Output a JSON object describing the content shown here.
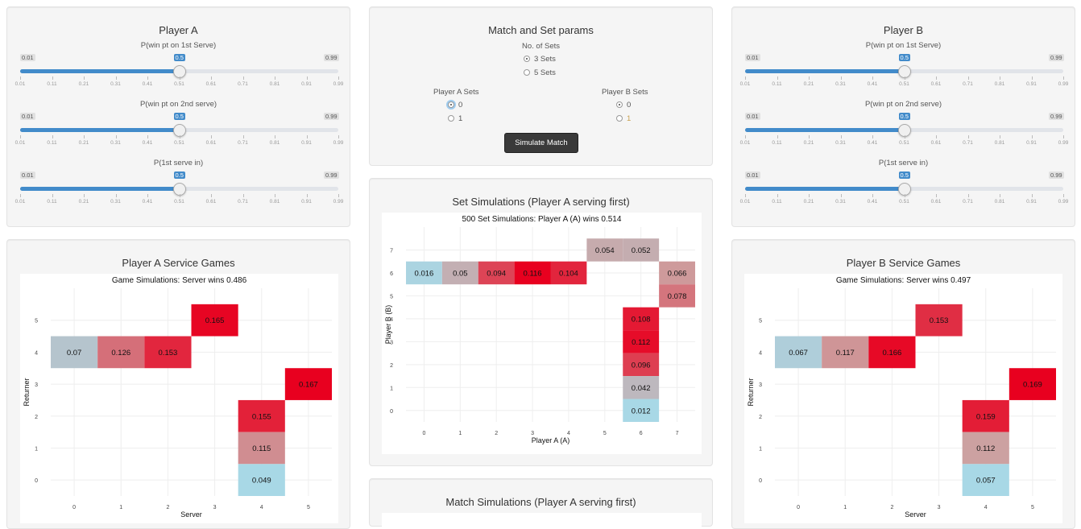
{
  "player_a": {
    "title": "Player A",
    "sliders": [
      {
        "label": "P(win pt on 1st Serve)",
        "min": "0.01",
        "max": "0.99",
        "value": "0.5",
        "fraction": 0.5
      },
      {
        "label": "P(win pt on 2nd serve)",
        "min": "0.01",
        "max": "0.99",
        "value": "0.5",
        "fraction": 0.5
      },
      {
        "label": "P(1st serve in)",
        "min": "0.01",
        "max": "0.99",
        "value": "0.5",
        "fraction": 0.5
      }
    ]
  },
  "player_b": {
    "title": "Player B",
    "sliders": [
      {
        "label": "P(win pt on 1st Serve)",
        "min": "0.01",
        "max": "0.99",
        "value": "0.5",
        "fraction": 0.5
      },
      {
        "label": "P(win pt on 2nd serve)",
        "min": "0.01",
        "max": "0.99",
        "value": "0.5",
        "fraction": 0.5
      },
      {
        "label": "P(1st serve in)",
        "min": "0.01",
        "max": "0.99",
        "value": "0.5",
        "fraction": 0.5
      }
    ]
  },
  "slider_ticks": [
    "0.01",
    "0.11",
    "0.21",
    "0.31",
    "0.41",
    "0.51",
    "0.61",
    "0.71",
    "0.81",
    "0.91",
    "0.99"
  ],
  "match_params": {
    "title": "Match and Set params",
    "sets_label": "No. of Sets",
    "sets_options": [
      {
        "label": "3 Sets",
        "selected": true
      },
      {
        "label": "5 Sets",
        "selected": false
      }
    ],
    "player_a_sets_label": "Player A Sets",
    "player_a_sets_options": [
      {
        "label": "0",
        "selected": true
      },
      {
        "label": "1",
        "selected": false
      }
    ],
    "player_b_sets_label": "Player B Sets",
    "player_b_sets_options": [
      {
        "label": "0",
        "selected": true
      },
      {
        "label": "1",
        "selected": false
      }
    ],
    "simulate_button": "Simulate Match"
  },
  "set_sim_panel": {
    "title": "Set Simulations (Player A serving first)"
  },
  "match_sim_panel": {
    "title": "Match Simulations (Player A serving first)"
  },
  "a_service_panel": {
    "title": "Player A Service Games"
  },
  "b_service_panel": {
    "title": "Player B Service Games"
  },
  "colors": {
    "low": "#a8d8e6",
    "high": "#e8001f",
    "accent": "#428bca"
  },
  "chart_data": [
    {
      "id": "player_a_games",
      "type": "heatmap",
      "title": "Game Simulations: Server wins 0.486",
      "xlabel": "Server",
      "ylabel": "Returner",
      "x_ticks": [
        "0",
        "1",
        "2",
        "3",
        "4",
        "5"
      ],
      "y_ticks": [
        "0",
        "1",
        "2",
        "3",
        "4",
        "5"
      ],
      "cells": [
        {
          "x": 0,
          "y": 4,
          "value": 0.07,
          "label": "0.07"
        },
        {
          "x": 1,
          "y": 4,
          "value": 0.126,
          "label": "0.126"
        },
        {
          "x": 2,
          "y": 4,
          "value": 0.153,
          "label": "0.153"
        },
        {
          "x": 3,
          "y": 5,
          "value": 0.165,
          "label": "0.165"
        },
        {
          "x": 5,
          "y": 3,
          "value": 0.167,
          "label": "0.167"
        },
        {
          "x": 4,
          "y": 2,
          "value": 0.155,
          "label": "0.155"
        },
        {
          "x": 4,
          "y": 1,
          "value": 0.115,
          "label": "0.115"
        },
        {
          "x": 4,
          "y": 0,
          "value": 0.049,
          "label": "0.049"
        }
      ]
    },
    {
      "id": "set_sims",
      "type": "heatmap",
      "title": "500 Set Simulations: Player A (A) wins 0.514",
      "xlabel": "Player A (A)",
      "ylabel": "Player B (B)",
      "x_ticks": [
        "0",
        "1",
        "2",
        "3",
        "4",
        "5",
        "6",
        "7"
      ],
      "y_ticks": [
        "0",
        "1",
        "2",
        "3",
        "4",
        "5",
        "6",
        "7"
      ],
      "cells": [
        {
          "x": 0,
          "y": 6,
          "value": 0.016,
          "label": "0.016"
        },
        {
          "x": 1,
          "y": 6,
          "value": 0.05,
          "label": "0.05"
        },
        {
          "x": 2,
          "y": 6,
          "value": 0.094,
          "label": "0.094"
        },
        {
          "x": 3,
          "y": 6,
          "value": 0.116,
          "label": "0.116"
        },
        {
          "x": 4,
          "y": 6,
          "value": 0.104,
          "label": "0.104"
        },
        {
          "x": 5,
          "y": 7,
          "value": 0.054,
          "label": "0.054"
        },
        {
          "x": 6,
          "y": 7,
          "value": 0.052,
          "label": "0.052"
        },
        {
          "x": 7,
          "y": 6,
          "value": 0.066,
          "label": "0.066"
        },
        {
          "x": 7,
          "y": 5,
          "value": 0.078,
          "label": "0.078"
        },
        {
          "x": 6,
          "y": 4,
          "value": 0.108,
          "label": "0.108"
        },
        {
          "x": 6,
          "y": 3,
          "value": 0.112,
          "label": "0.112"
        },
        {
          "x": 6,
          "y": 2,
          "value": 0.096,
          "label": "0.096"
        },
        {
          "x": 6,
          "y": 1,
          "value": 0.042,
          "label": "0.042"
        },
        {
          "x": 6,
          "y": 0,
          "value": 0.012,
          "label": "0.012"
        }
      ]
    },
    {
      "id": "player_b_games",
      "type": "heatmap",
      "title": "Game Simulations: Server wins 0.497",
      "xlabel": "Server",
      "ylabel": "Returner",
      "x_ticks": [
        "0",
        "1",
        "2",
        "3",
        "4",
        "5"
      ],
      "y_ticks": [
        "0",
        "1",
        "2",
        "3",
        "4",
        "5"
      ],
      "cells": [
        {
          "x": 0,
          "y": 4,
          "value": 0.067,
          "label": "0.067"
        },
        {
          "x": 1,
          "y": 4,
          "value": 0.117,
          "label": "0.117"
        },
        {
          "x": 2,
          "y": 4,
          "value": 0.166,
          "label": "0.166"
        },
        {
          "x": 3,
          "y": 5,
          "value": 0.153,
          "label": "0.153"
        },
        {
          "x": 5,
          "y": 3,
          "value": 0.169,
          "label": "0.169"
        },
        {
          "x": 4,
          "y": 2,
          "value": 0.159,
          "label": "0.159"
        },
        {
          "x": 4,
          "y": 1,
          "value": 0.112,
          "label": "0.112"
        },
        {
          "x": 4,
          "y": 0,
          "value": 0.057,
          "label": "0.057"
        }
      ]
    }
  ]
}
